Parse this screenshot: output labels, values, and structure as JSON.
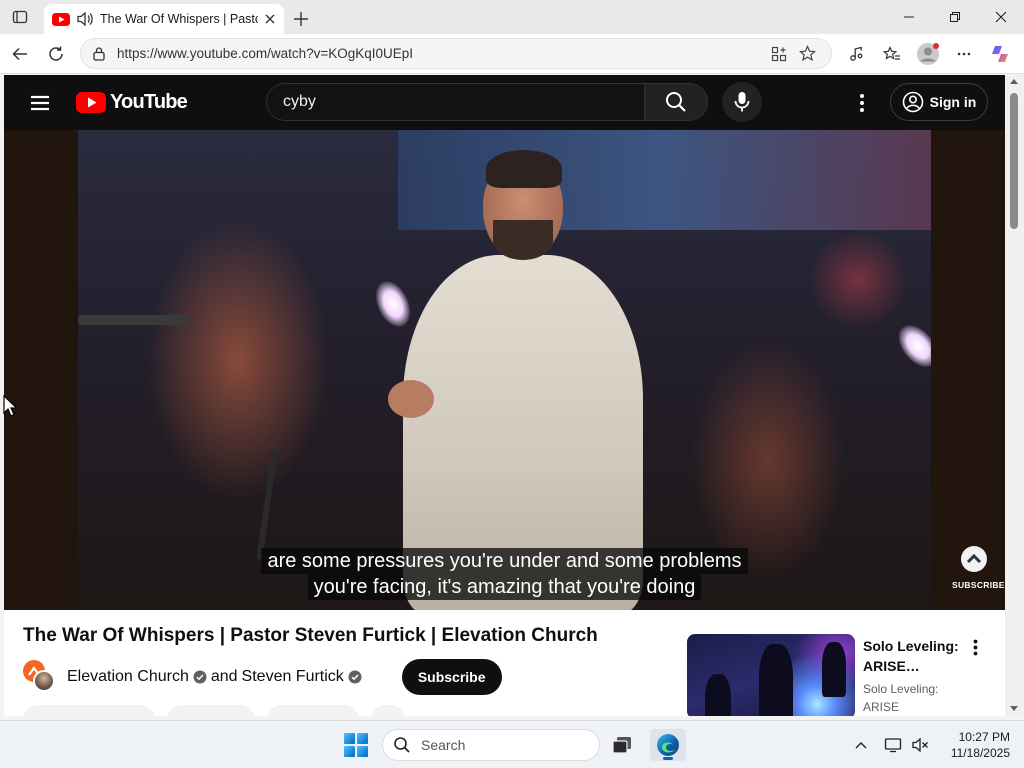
{
  "browser": {
    "tab_title": "The War Of Whispers | Pastor Steven Furtick | Elevation Church",
    "url": "https://www.youtube.com/watch?v=KOgKqI0UEpI"
  },
  "youtube": {
    "logo_text": "YouTube",
    "search_value": "cyby",
    "sign_in_label": "Sign in"
  },
  "player": {
    "caption_line1": "are some pressures you're under and some problems",
    "caption_line2": "you're facing, it's amazing that you're doing",
    "watermark_label": "SUBSCRIBE"
  },
  "video": {
    "title": "The War Of Whispers | Pastor Steven Furtick | Elevation Church",
    "channel1": "Elevation Church",
    "joiner": "and",
    "channel2": "Steven Furtick",
    "subscribe_label": "Subscribe"
  },
  "recommendation": {
    "title": "Solo Leveling: ARISE…",
    "channel": "Solo Leveling: ARISE OVERDRIVE"
  },
  "taskbar": {
    "search_placeholder": "Search",
    "time": "10:27 PM",
    "date": "11/18/2025"
  },
  "colors": {
    "yt_red": "#ff0000",
    "yt_header": "#0f0f0f",
    "edge_blue": "#0067c0",
    "elevation_orange": "#f26522"
  }
}
